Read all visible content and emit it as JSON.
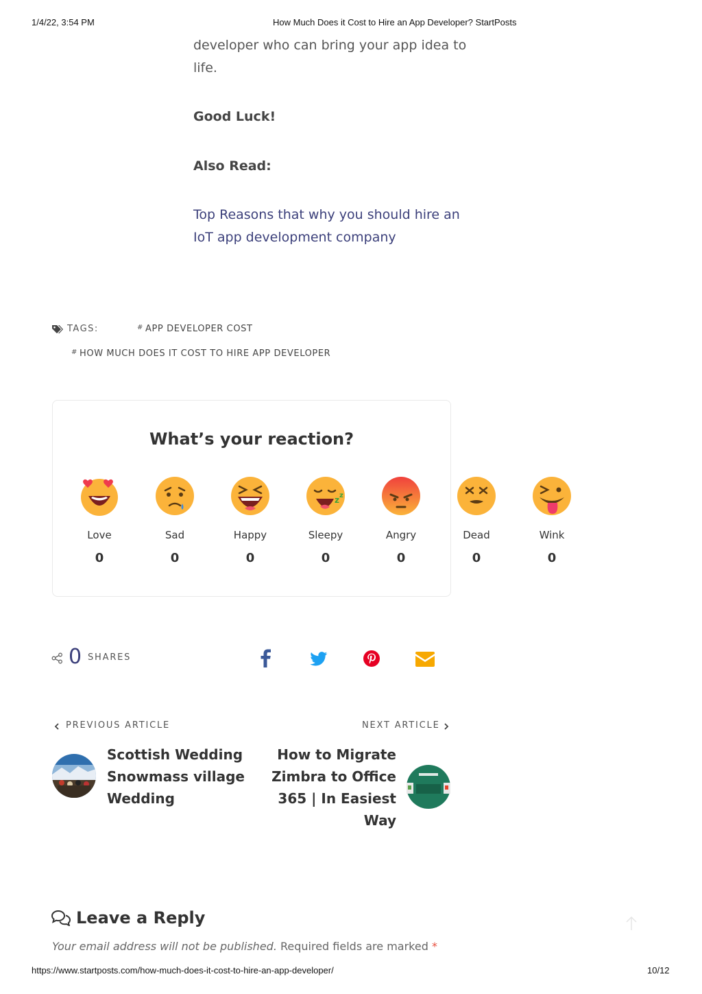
{
  "print_header": {
    "datetime": "1/4/22, 3:54 PM",
    "title": "How Much Does it Cost to Hire an App Developer? StartPosts"
  },
  "print_footer": {
    "url": "https://www.startposts.com/how-much-does-it-cost-to-hire-an-app-developer/",
    "page": "10/12"
  },
  "article": {
    "line1": "developer who can bring your app idea to",
    "line2": "life.",
    "good_luck": "Good Luck!",
    "also_read": "Also Read:",
    "link_line1": "Top Reasons that why you should hire an",
    "link_line2": "IoT app development company"
  },
  "tags": {
    "label": "TAGS:",
    "hash": "#",
    "items": [
      "APP DEVELOPER COST",
      "HOW MUCH DOES IT COST TO HIRE APP DEVELOPER"
    ]
  },
  "reactions": {
    "title": "What’s your reaction?",
    "items": [
      {
        "label": "Love",
        "count": "0",
        "icon": "love-emoji-icon"
      },
      {
        "label": "Sad",
        "count": "0",
        "icon": "sad-emoji-icon"
      },
      {
        "label": "Happy",
        "count": "0",
        "icon": "happy-emoji-icon"
      },
      {
        "label": "Sleepy",
        "count": "0",
        "icon": "sleepy-emoji-icon"
      },
      {
        "label": "Angry",
        "count": "0",
        "icon": "angry-emoji-icon"
      },
      {
        "label": "Dead",
        "count": "0",
        "icon": "dead-emoji-icon"
      },
      {
        "label": "Wink",
        "count": "0",
        "icon": "wink-emoji-icon"
      }
    ]
  },
  "share": {
    "count": "0",
    "label": "SHARES",
    "buttons": [
      "facebook-icon",
      "twitter-icon",
      "pinterest-icon",
      "email-icon"
    ],
    "colors": {
      "facebook": "#3b5998",
      "twitter": "#1da1f2",
      "pinterest": "#e60023",
      "email": "#f7a800"
    }
  },
  "nav": {
    "prev_label": "PREVIOUS ARTICLE",
    "prev_title_lines": [
      "Scottish Wedding",
      "Snowmass village",
      "Wedding"
    ],
    "next_label": "NEXT ARTICLE",
    "next_title_lines": [
      "How to Migrate",
      "Zimbra to Office",
      "365 | In Easiest",
      "Way"
    ]
  },
  "reply": {
    "title": "Leave a Reply",
    "note_italic": "Your email address will not be published.",
    "note_rest": "Required fields are marked",
    "required_mark": "*"
  }
}
